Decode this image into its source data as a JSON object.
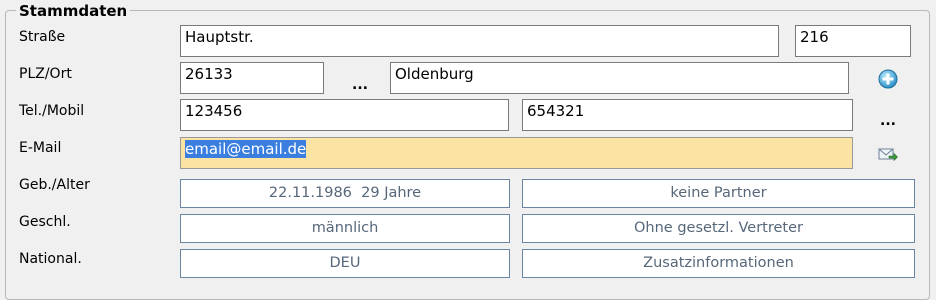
{
  "group": {
    "title": "Stammdaten"
  },
  "labels": {
    "street": "Straße",
    "plz_city": "PLZ/Ort",
    "phone_mobile": "Tel./Mobil",
    "email": "E-Mail",
    "birth_age": "Geb./Alter",
    "gender": "Geschl.",
    "nationality": "National."
  },
  "fields": {
    "street": "Hauptstr.",
    "house_number": "216",
    "plz": "26133",
    "city": "Oldenburg",
    "phone": "123456",
    "mobile": "654321",
    "email": "email@email.de"
  },
  "dots": {
    "plz_lookup": "...",
    "phone_more": "..."
  },
  "buttons": {
    "birth_age": "22.11.1986  29 Jahre",
    "partner": "keine Partner",
    "gender": "männlich",
    "legal_rep": "Ohne gesetzl. Vertreter",
    "nationality": "DEU",
    "additional_info": "Zusatzinformationen"
  },
  "icons": {
    "add_city": "add-circle-icon",
    "send_mail": "send-mail-icon"
  },
  "colors": {
    "email_highlight": "#fbe3a3",
    "selection": "#3a7fe0",
    "button_text": "#56677a",
    "button_border": "#6a86a3"
  }
}
